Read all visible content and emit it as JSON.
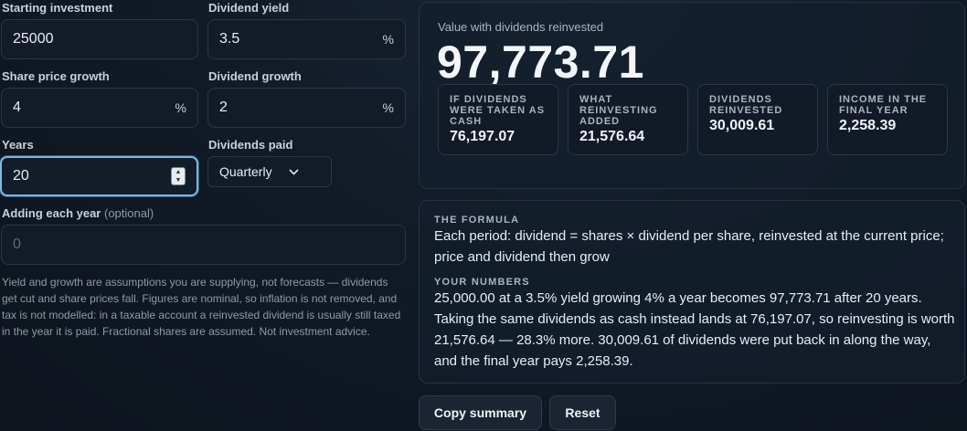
{
  "inputs": {
    "starting_investment": {
      "label": "Starting investment",
      "value": "25000"
    },
    "dividend_yield": {
      "label": "Dividend yield",
      "value": "3.5",
      "unit": "%"
    },
    "share_price_growth": {
      "label": "Share price growth",
      "value": "4",
      "unit": "%"
    },
    "dividend_growth": {
      "label": "Dividend growth",
      "value": "2",
      "unit": "%"
    },
    "years": {
      "label": "Years",
      "value": "20"
    },
    "dividends_paid": {
      "label": "Dividends paid",
      "selected": "Quarterly"
    },
    "adding_each_year": {
      "label": "Adding each year",
      "optional": "(optional)",
      "placeholder": "0"
    }
  },
  "disclaimer": "Yield and growth are assumptions you are supplying, not forecasts — dividends get cut and share prices fall. Figures are nominal, so inflation is not removed, and tax is not modelled: in a taxable account a reinvested dividend is usually still taxed in the year it is paid. Fractional shares are assumed. Not investment advice.",
  "result": {
    "label": "Value with dividends reinvested",
    "value": "97,773.71",
    "stats": [
      {
        "label": "If dividends were taken as cash",
        "value": "76,197.07"
      },
      {
        "label": "What reinvesting added",
        "value": "21,576.64"
      },
      {
        "label": "Dividends reinvested",
        "value": "30,009.61"
      },
      {
        "label": "Income in the final year",
        "value": "2,258.39"
      }
    ]
  },
  "formula": {
    "heading": "THE FORMULA",
    "text": "Each period: dividend = shares × dividend per share, reinvested at the current price; price and dividend then grow",
    "numbers_heading": "YOUR NUMBERS",
    "numbers_text": "25,000.00 at a 3.5% yield growing 4% a year becomes 97,773.71 after 20 years. Taking the same dividends as cash instead lands at 76,197.07, so reinvesting is worth 21,576.64 — 28.3% more. 30,009.61 of dividends were put back in along the way, and the final year pays 2,258.39."
  },
  "buttons": {
    "copy": "Copy summary",
    "reset": "Reset"
  }
}
